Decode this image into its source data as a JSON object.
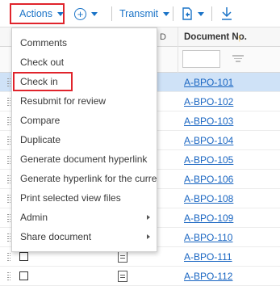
{
  "toolbar": {
    "actions_label": "Actions",
    "transmit_label": "Transmit",
    "plus_glyph": "+"
  },
  "grid": {
    "header_doc_number": "Document No.",
    "header_stub": "D",
    "rows": [
      {
        "doc_no": "A-BPO-101",
        "selected": true
      },
      {
        "doc_no": "A-BPO-102"
      },
      {
        "doc_no": "A-BPO-103"
      },
      {
        "doc_no": "A-BPO-104"
      },
      {
        "doc_no": "A-BPO-105"
      },
      {
        "doc_no": "A-BPO-106"
      },
      {
        "doc_no": "A-BPO-108"
      },
      {
        "doc_no": "A-BPO-109"
      },
      {
        "doc_no": "A-BPO-110"
      },
      {
        "doc_no": "A-BPO-111"
      },
      {
        "doc_no": "A-BPO-112"
      }
    ]
  },
  "menu": {
    "items": [
      {
        "label": "Comments"
      },
      {
        "label": "Check out"
      },
      {
        "label": "Check in",
        "highlighted": true
      },
      {
        "label": "Resubmit for review"
      },
      {
        "label": "Compare"
      },
      {
        "label": "Duplicate"
      },
      {
        "label": "Generate document hyperlink"
      },
      {
        "label": "Generate hyperlink for the current r..."
      },
      {
        "label": "Print selected view files"
      },
      {
        "label": "Admin",
        "submenu": true
      },
      {
        "label": "Share document",
        "submenu": true
      }
    ]
  },
  "colors": {
    "accent": "#1a73c7",
    "highlight_box": "#e0242c",
    "selected_row": "#cfe2f7",
    "sort_icon": "#e6a919"
  }
}
